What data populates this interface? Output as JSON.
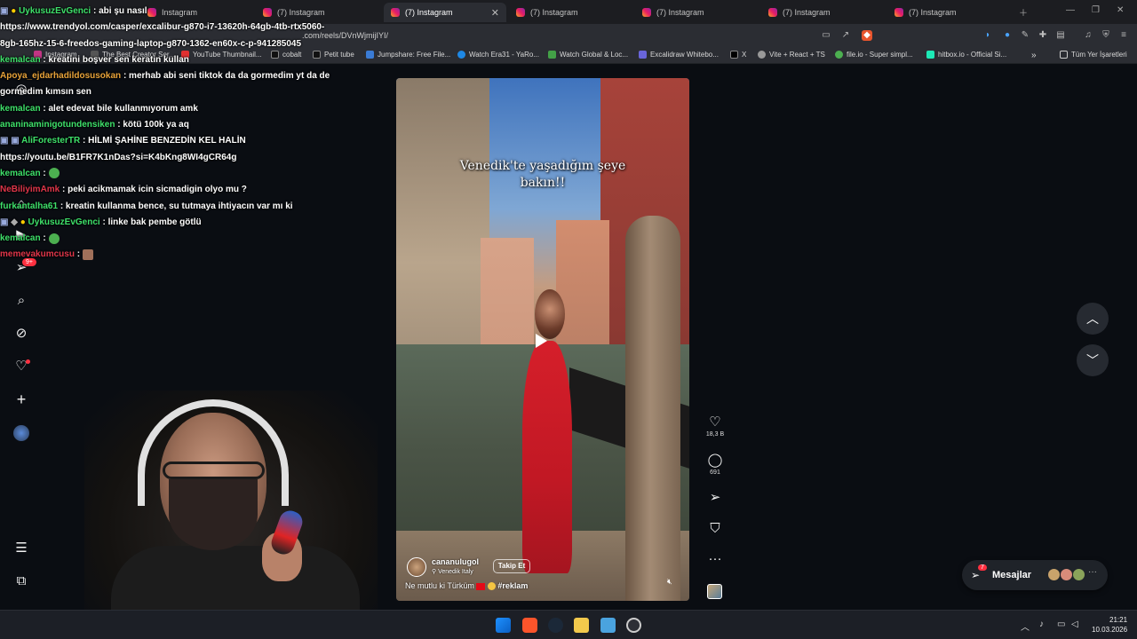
{
  "browser": {
    "tabs": [
      {
        "label": "Instagram",
        "active": false
      },
      {
        "label": "(7) Instagram",
        "active": false
      },
      {
        "label": "(7) Instagram",
        "active": true
      },
      {
        "label": "(7) Instagram",
        "active": false
      },
      {
        "label": "(7) Instagram",
        "active": false
      },
      {
        "label": "(7) Instagram",
        "active": false
      },
      {
        "label": "(7) Instagram",
        "active": false
      }
    ],
    "url": ".com/reels/DVnWjmijIYI/",
    "bookmarks": [
      "Instagram",
      "The Best Creator Ser...",
      "YouTube Thumbnail...",
      "cobalt",
      "Petit tube",
      "Jumpshare: Free File...",
      "Watch Era31 - YaRo...",
      "Watch Global & Loc...",
      "Excalidraw Whitebo...",
      "X",
      "Vite + React + TS",
      "file.io - Super simpl...",
      "hitbox.io - Official Si..."
    ],
    "all_bookmarks": "Tüm Yer İşaretleri"
  },
  "chat": [
    {
      "user": "UykusuzEvGenci",
      "color": "#3ee06a",
      "text": ": abi şu nasıl"
    },
    {
      "user": "",
      "color": "#ffffff",
      "text": "https://www.trendyol.com/casper/excalibur-g870-i7-13620h-64gb-4tb-rtx5060-"
    },
    {
      "user": "",
      "color": "#ffffff",
      "text": "8gb-165hz-15-6-freedos-gaming-laptop-g870-1362-en60x-c-p-941285045"
    },
    {
      "user": "kemalcan",
      "color": "#3ee06a",
      "text": ": kreatini boşver sen keratin kullan"
    },
    {
      "user": "Apoya_ejdarhadildosusokan",
      "color": "#e8a33a",
      "text": ": merhab abi seni tiktok da da gormedim yt da de"
    },
    {
      "user": "",
      "color": "#ffffff",
      "text": "gormedim kımsın sen"
    },
    {
      "user": "kemalcan",
      "color": "#3ee06a",
      "text": ": alet edevat bile kullanmıyorum amk"
    },
    {
      "user": "ananinaminigotundensiken",
      "color": "#3ee06a",
      "text": ": kötü 100k ya aq"
    },
    {
      "user": "AliForesterTR",
      "color": "#3ee06a",
      "text": ": HİLMİ ŞAHİNE BENZEDİN KEL HALİN"
    },
    {
      "user": "",
      "color": "#ffffff",
      "text": "https://youtu.be/B1FR7K1nDas?si=K4bKng8WI4gCR64g"
    },
    {
      "user": "kemalcan",
      "color": "#3ee06a",
      "text": ":"
    },
    {
      "user": "NeBiliyimAmk",
      "color": "#e0364a",
      "text": ": peki acikmamak icin sicmadigin olyo mu ?"
    },
    {
      "user": "furkantalha61",
      "color": "#3ee06a",
      "text": ": kreatin kullanma bence, su tutmaya ihtiyacın var mı ki"
    },
    {
      "user": "UykusuzEvGenci",
      "color": "#3ee06a",
      "text": ": linke bak pembe götlü"
    },
    {
      "user": "kemalcan",
      "color": "#3ee06a",
      "text": ":"
    },
    {
      "user": "memevakumcusu",
      "color": "#e0364a",
      "text": ":"
    }
  ],
  "sidebar": {
    "notification_badge": "9+"
  },
  "reel": {
    "overlay_text": "Venedik'te yaşadığım şeye bakın!!",
    "username": "cananulugol",
    "location": "Venedik Italy",
    "follow_label": "Takip Et",
    "description": "Ne mutlu ki Türküm",
    "hashtag": "#reklam",
    "likes": "18,3 B",
    "comments": "691"
  },
  "messages": {
    "label": "Mesajlar",
    "badge": "7"
  },
  "taskbar": {
    "time": "21:21",
    "date": "10.03.2026"
  },
  "colors": {
    "accent": "#ff3040",
    "page_bg": "#0a0d12"
  }
}
